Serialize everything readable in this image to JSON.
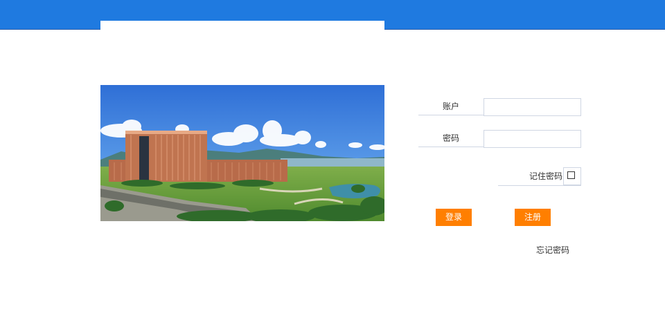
{
  "header": {
    "bar_color": "#1f7ae0"
  },
  "hero": {
    "image_alt": "campus-building-photo"
  },
  "login": {
    "account_label": "账户",
    "account_value": "",
    "password_label": "密码",
    "password_value": "",
    "remember_label": "记住密码",
    "remember_checked": false,
    "login_button": "登录",
    "register_button": "注册",
    "forgot_link": "忘记密码",
    "button_color": "#ff7f00"
  }
}
